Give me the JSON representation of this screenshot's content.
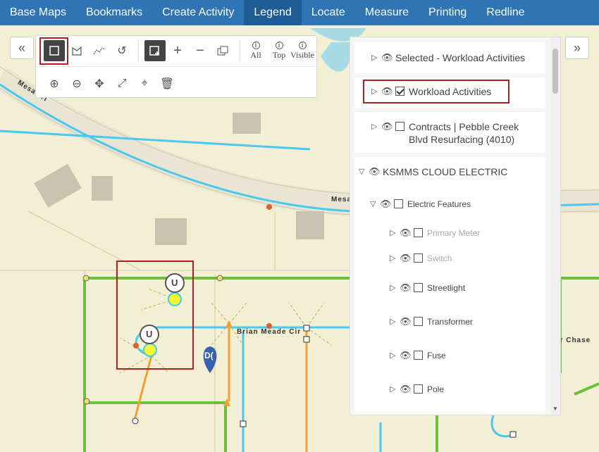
{
  "nav": {
    "items": [
      "Base Maps",
      "Bookmarks",
      "Create Activity",
      "Legend",
      "Locate",
      "Measure",
      "Printing",
      "Redline"
    ],
    "active": "Legend"
  },
  "toolbar": {
    "all_label": "All",
    "top_label": "Top",
    "visible_label": "Visible"
  },
  "legend": {
    "selected_workload": "Selected - Workload Activities",
    "workload_activities": "Workload Activities",
    "contracts": "Contracts | Pebble Creek Blvd Resurfacing (4010)",
    "ksmms": "KSMMS CLOUD ELECTRIC",
    "electric_features": "Electric Features",
    "primary_meter": "Primary Meter",
    "switch": "Switch",
    "streetlight": "Streetlight",
    "transformer": "Transformer",
    "fuse": "Fuse",
    "pole": "Pole"
  },
  "map": {
    "street_mesa_tri": "Mesa Tri",
    "street_mesa": "Mesa",
    "street_brian_meade": "Brian Meade Cir",
    "street_chase": "er Chase",
    "marker_u": "U",
    "marker_d": "D("
  },
  "colors": {
    "nav_bg": "#2f74b5",
    "primary_line": "#4bc8f0",
    "secondary_line": "#6cbf3c",
    "orange_line": "#f0a030",
    "highlight_box": "#b02020"
  }
}
